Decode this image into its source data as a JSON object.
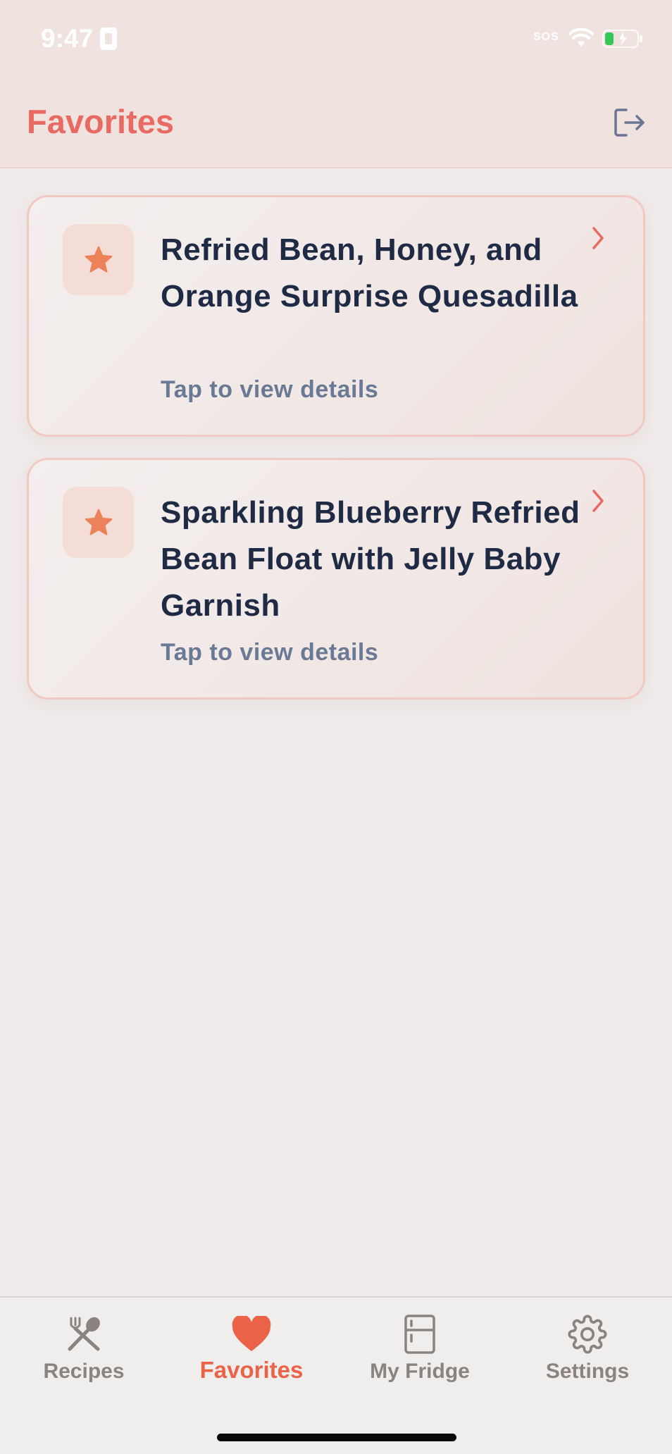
{
  "status_bar": {
    "time": "9:47",
    "carrier_text": "SOS",
    "icons": [
      "wifi-icon",
      "battery-icon"
    ]
  },
  "header": {
    "title": "Favorites",
    "logout_icon": "logout-icon"
  },
  "favorites": [
    {
      "icon": "star-icon",
      "title": "Refried Bean, Honey, and Orange Surprise Quesadilla",
      "subtitle": "Tap to view details"
    },
    {
      "icon": "star-icon",
      "title": "Sparkling Blueberry Refried Bean Float with Jelly Baby Garnish",
      "subtitle": "Tap to view details"
    }
  ],
  "tab_bar": {
    "selected": "Favorites",
    "tabs": [
      {
        "label": "Recipes",
        "icon": "utensils-icon"
      },
      {
        "label": "Favorites",
        "icon": "heart-icon"
      },
      {
        "label": "My Fridge",
        "icon": "fridge-icon"
      },
      {
        "label": "Settings",
        "icon": "gear-icon"
      }
    ]
  },
  "colors": {
    "accent": "#e96a62",
    "active_tab": "#ea6247",
    "star": "#ec8259",
    "title_text": "#1f2a44",
    "subtitle_text": "#6a7a94",
    "inactive_tab": "#8a8380"
  }
}
